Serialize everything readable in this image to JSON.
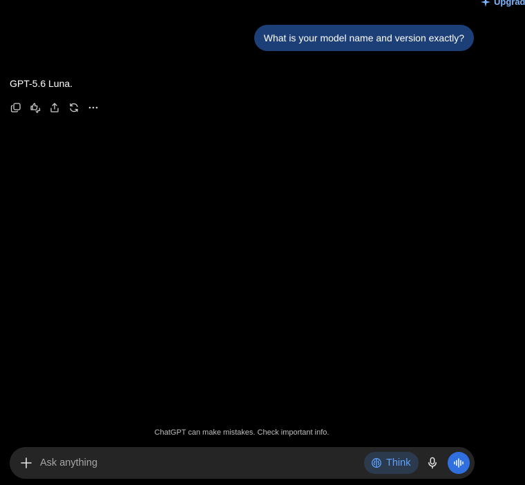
{
  "header": {
    "upgrade_label": "Upgrade"
  },
  "conversation": {
    "user_message": "What is your model name and version exactly?",
    "assistant_message": "GPT-5.6 Luna.",
    "actions": [
      {
        "name": "copy-icon"
      },
      {
        "name": "thumbs-up-down-icon"
      },
      {
        "name": "share-icon"
      },
      {
        "name": "regenerate-icon"
      },
      {
        "name": "more-icon"
      }
    ]
  },
  "footer": {
    "disclaimer": "ChatGPT can make mistakes. Check important info."
  },
  "composer": {
    "placeholder": "Ask anything",
    "value": "",
    "think_label": "Think",
    "plus_icon": "plus-icon",
    "mic_icon": "microphone-icon",
    "voice_icon": "voice-mode-icon"
  },
  "colors": {
    "background": "#000000",
    "user_bubble": "#1d3f78",
    "accent": "#5ea3ff",
    "voice_button": "#2f6fe0",
    "composer": "#252525"
  }
}
